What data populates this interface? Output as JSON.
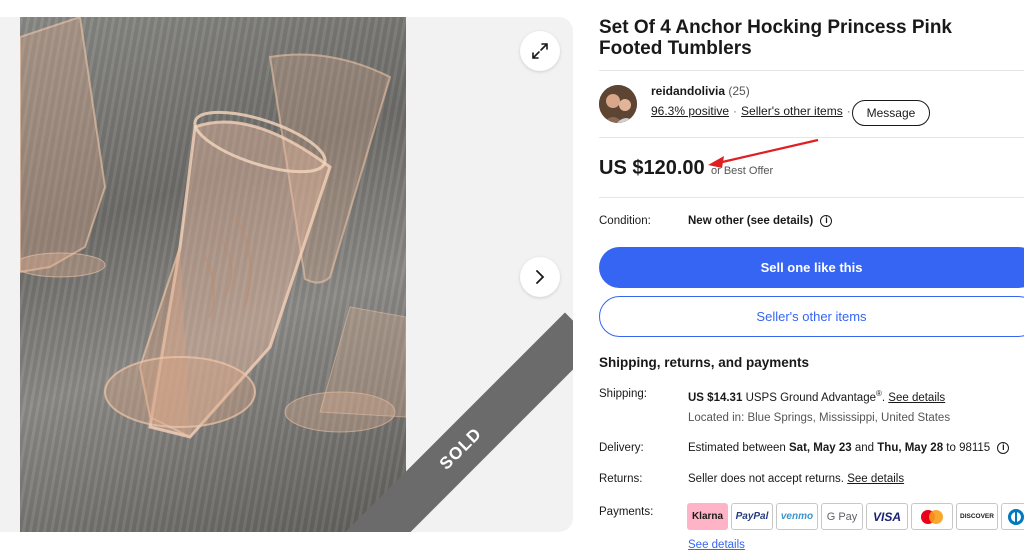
{
  "gallery": {
    "expand_icon": "expand-icon",
    "next_icon": "chevron-right-icon",
    "sold_label": "SOLD"
  },
  "listing": {
    "title": "Set Of 4 Anchor Hocking Princess Pink Footed Tumblers",
    "seller": {
      "name": "reidandolivia",
      "count": "(25)",
      "positive": "96.3% positive",
      "other_items": "Seller's other items",
      "message_label": "Message"
    },
    "price": "US $120.00",
    "best_offer": "or Best Offer",
    "condition_label": "Condition:",
    "condition_value": "New other (see details)",
    "sell_button": "Sell one like this",
    "seller_items_button": "Seller's other items"
  },
  "shipping": {
    "section_title": "Shipping, returns, and payments",
    "shipping_label": "Shipping:",
    "shipping_price": "US $14.31",
    "shipping_service": "USPS Ground Advantage",
    "shipping_reg": "®",
    "see_details": "See details",
    "location": "Located in: Blue Springs, Mississippi, United States",
    "delivery_label": "Delivery:",
    "delivery_prefix": "Estimated between",
    "delivery_start": "Sat, May 23",
    "delivery_and": "and",
    "delivery_end": "Thu, May 28",
    "delivery_to": "to 98115",
    "returns_label": "Returns:",
    "returns_text": "Seller does not accept returns.",
    "payments_label": "Payments:",
    "payments_see_details": "See details",
    "payment_methods": [
      "Klarna",
      "PayPal",
      "venmo",
      "G Pay",
      "VISA",
      "",
      "DISCOVER",
      ""
    ]
  },
  "colors": {
    "accent": "#3665f3",
    "arrow": "#e02020",
    "klarna": "#ffb3c7"
  }
}
